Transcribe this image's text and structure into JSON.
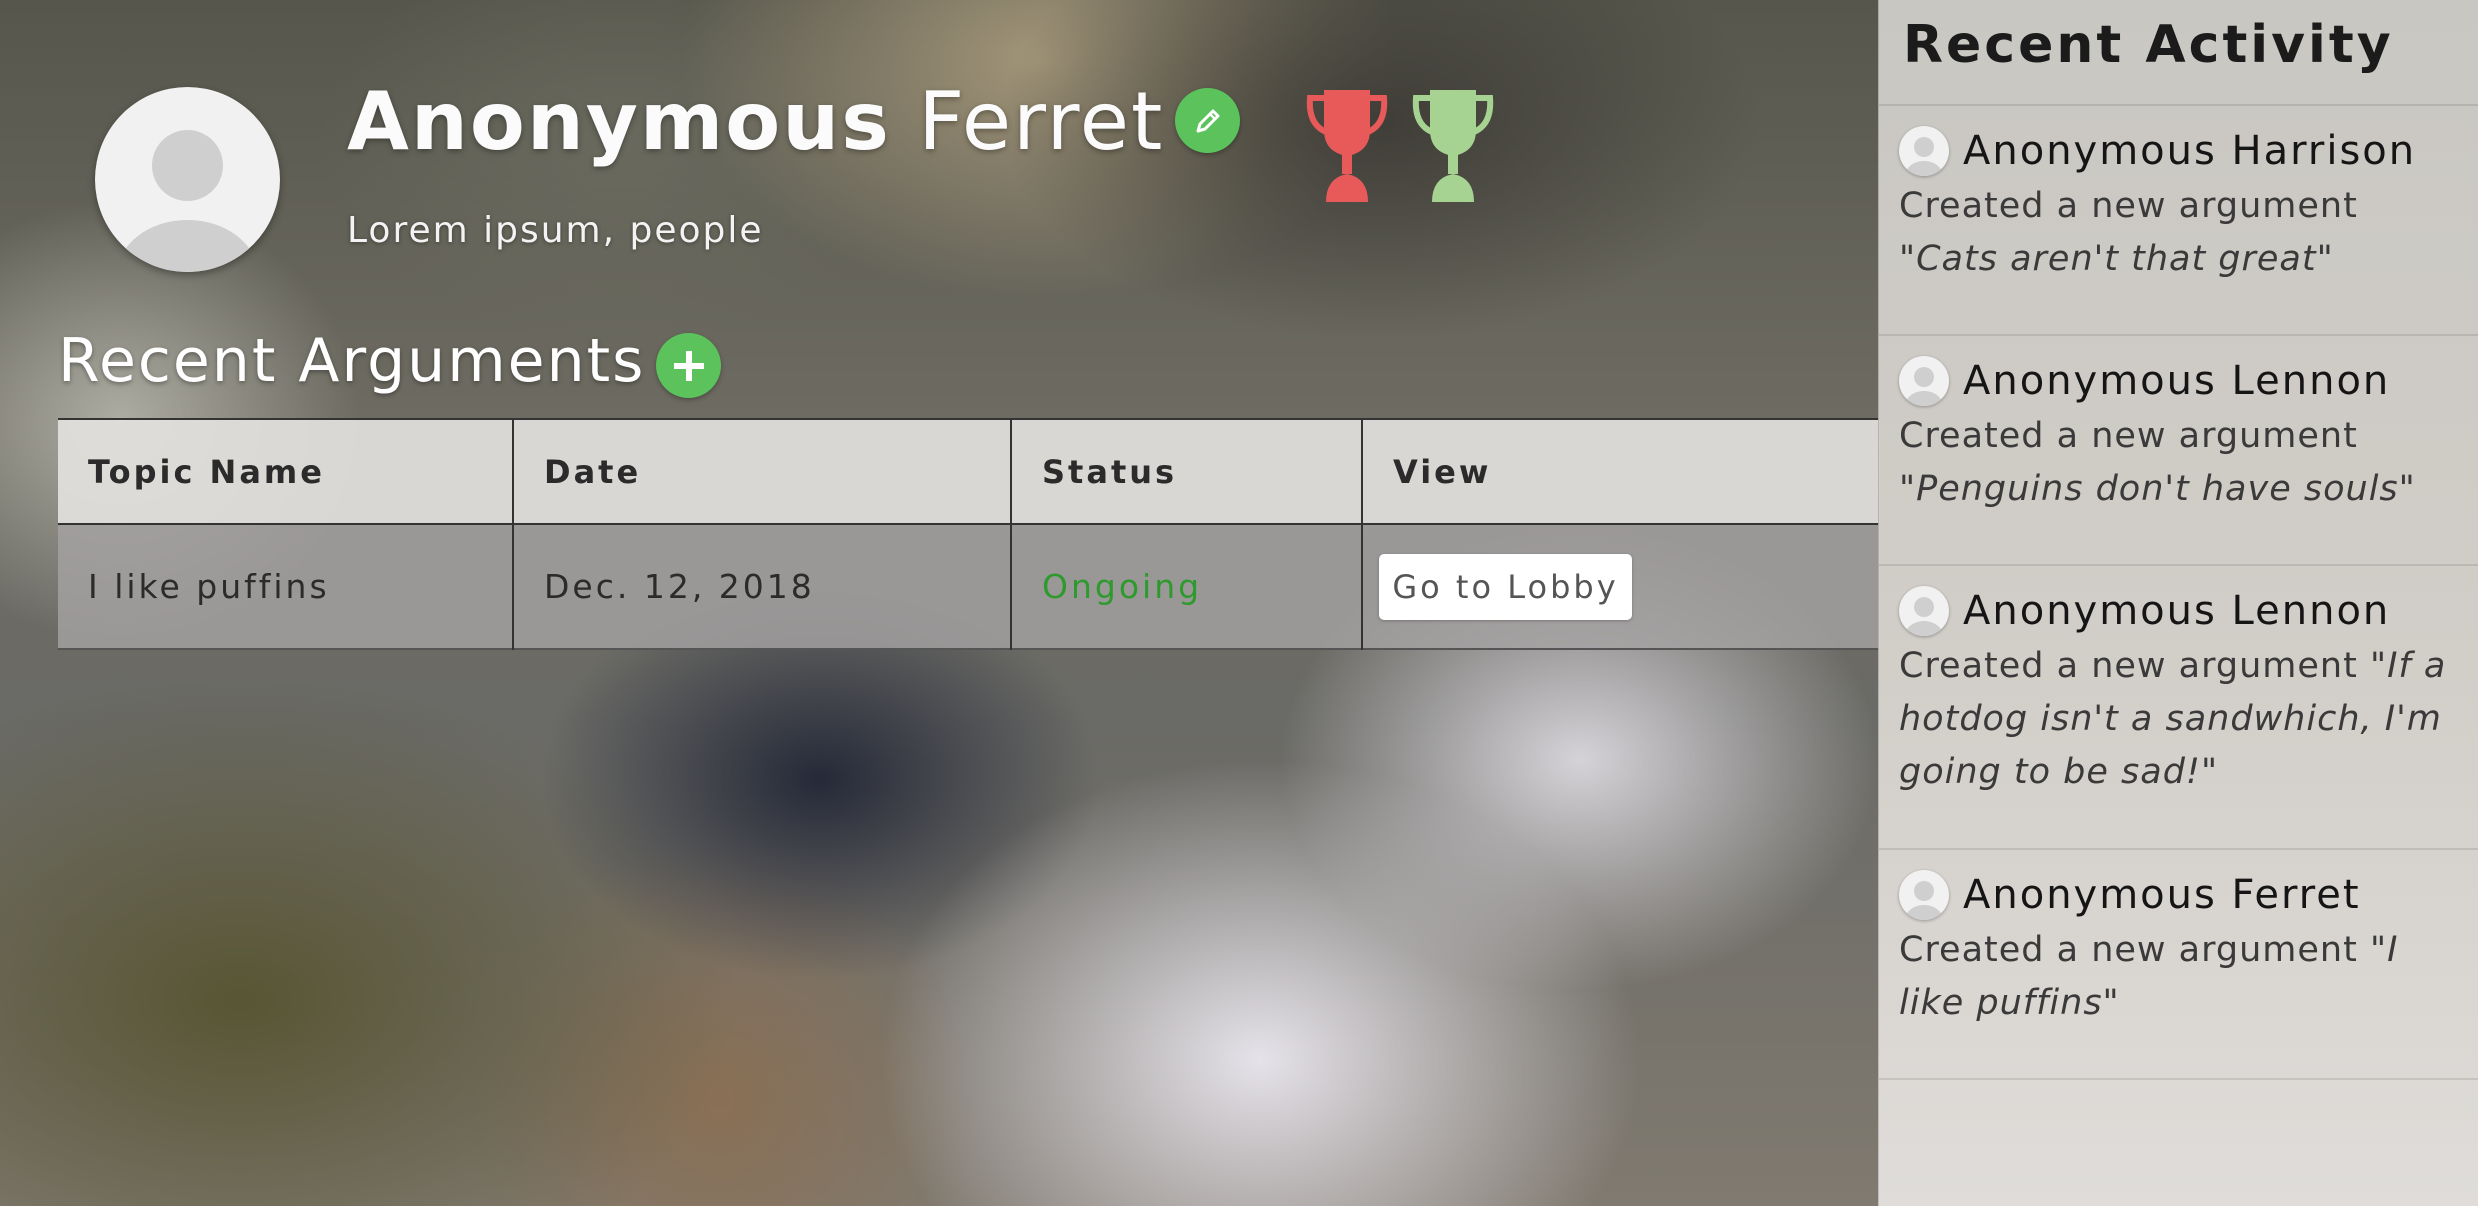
{
  "profile": {
    "first_name": "Anonymous",
    "last_name": "Ferret",
    "tagline": "Lorem ipsum, people",
    "edit_icon": "pencil-icon",
    "trophies": [
      {
        "icon": "trophy-icon",
        "color": "#e85a5a"
      },
      {
        "icon": "trophy-icon",
        "color": "#a6d392"
      }
    ]
  },
  "arguments_section": {
    "title": "Recent Arguments",
    "add_icon": "plus-icon",
    "columns": [
      "Topic Name",
      "Date",
      "Status",
      "View"
    ],
    "rows": [
      {
        "topic": "I like puffins",
        "date": "Dec. 12, 2018",
        "status": "Ongoing",
        "action_label": "Go to Lobby"
      }
    ]
  },
  "recent_activity": {
    "title": "Recent Activity",
    "items": [
      {
        "user": "Anonymous Harrison",
        "action": "Created a new argument",
        "topic": "\"Cats aren't that great\""
      },
      {
        "user": "Anonymous Lennon",
        "action": "Created a new argument",
        "topic": "\"Penguins don't have souls\""
      },
      {
        "user": "Anonymous Lennon",
        "action": "Created a new argument",
        "topic": "\"If a hotdog isn't a sandwhich, I'm going to be sad!\""
      },
      {
        "user": "Anonymous Ferret",
        "action": "Created a new argument",
        "topic": "\"I like puffins\""
      }
    ]
  },
  "colors": {
    "accent_green": "#5cc25c",
    "status_ongoing": "#2e9a2e",
    "trophy_red": "#e85a5a",
    "trophy_green": "#a6d392"
  }
}
